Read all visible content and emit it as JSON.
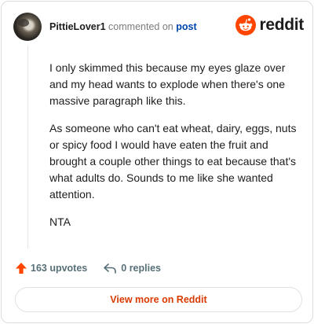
{
  "header": {
    "username": "PittieLover1",
    "action": "commented on",
    "target": "post",
    "brand": "reddit"
  },
  "comment": {
    "paragraphs": [
      "I only skimmed this because my eyes glaze over and my head wants to explode when there's one massive paragraph like this.",
      "As someone who can't eat wheat, dairy, eggs, nuts or spicy food I would have eaten the fruit and brought a couple other things to eat because that's what adults do. Sounds to me like she wanted attention.",
      "NTA"
    ]
  },
  "footer": {
    "upvotes": "163 upvotes",
    "replies": "0 replies"
  },
  "cta": {
    "label": "View more on Reddit"
  },
  "colors": {
    "accent": "#ff4500",
    "link": "#0045ac",
    "cta_text": "#d93a00",
    "muted": "#576f76"
  },
  "icons": {
    "avatar": "user-avatar",
    "brand": "reddit-snoo-icon",
    "upvote": "upvote-arrow-icon",
    "reply": "reply-arrow-icon"
  }
}
